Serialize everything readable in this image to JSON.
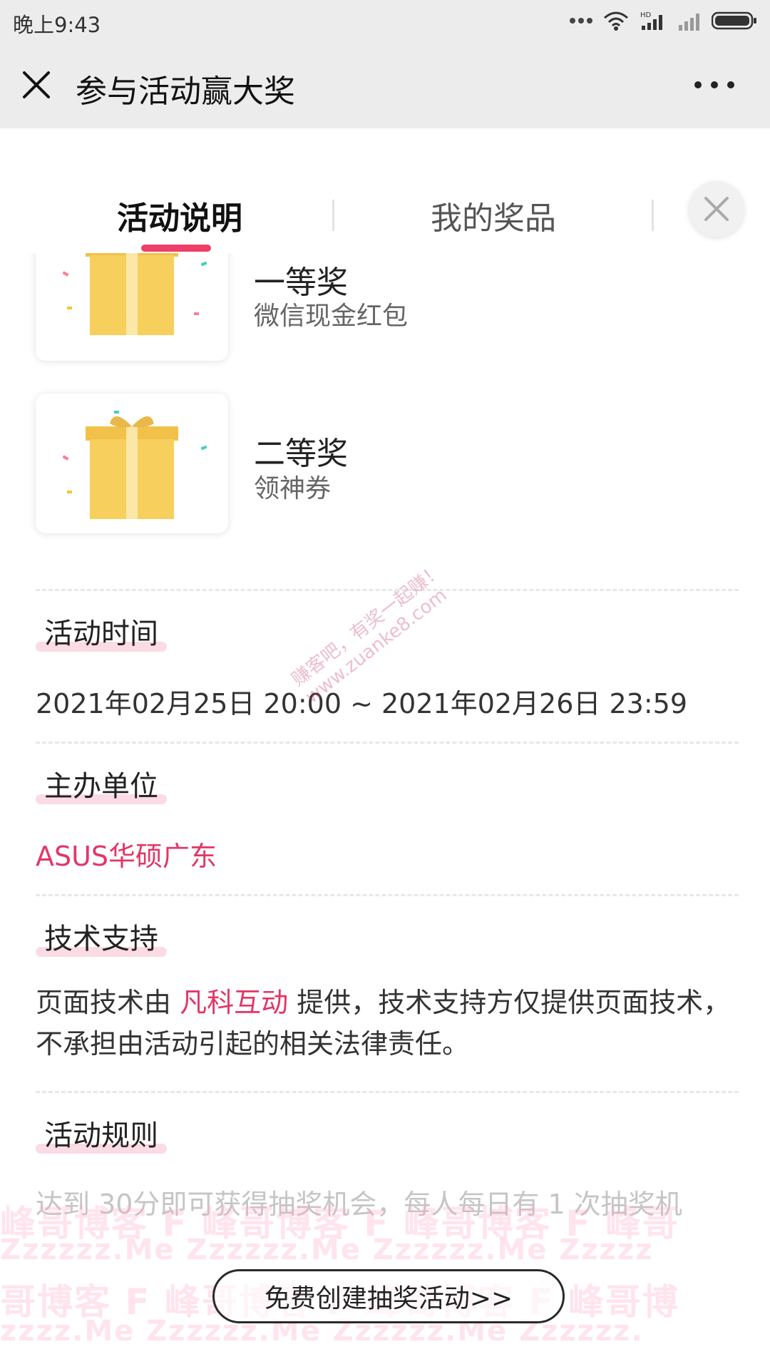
{
  "statusbar": {
    "time": "晚上9:43",
    "signal_label": "HD"
  },
  "navbar": {
    "title": "参与活动赢大奖"
  },
  "tabs": [
    {
      "label": "活动说明",
      "active": true
    },
    {
      "label": "我的奖品",
      "active": false
    }
  ],
  "prizes": [
    {
      "name": "一等奖",
      "desc": "微信现金红包"
    },
    {
      "name": "二等奖",
      "desc": "领神券"
    }
  ],
  "sections": {
    "time": {
      "title": "活动时间",
      "value": "2021年02月25日 20:00 ~ 2021年02月26日 23:59"
    },
    "organizer": {
      "title": "主办单位",
      "value": "ASUS华硕广东"
    },
    "tech": {
      "title": "技术支持",
      "prefix": "页面技术由 ",
      "link": "凡科互动",
      "suffix": " 提供，技术支持方仅提供页面技术，不承担由活动引起的相关法律责任。"
    },
    "rules": {
      "title": "活动规则",
      "text": "达到 30分即可获得抽奖机会，每人每日有 1 次抽奖机"
    }
  },
  "create_button": "免费创建抽奖活动>>",
  "watermarks": {
    "diagonal_1": "赚客吧，有奖一起赚！",
    "diagonal_2": "www.zuanke8.com",
    "band_1": "峰哥博客 F 峰哥博客 F 峰哥博客 F 峰哥",
    "band_2": "Zzzzzz.Me    Zzzzzz.Me    Zzzzzz.Me    Zzzzz",
    "band_3": "哥博客 F 峰哥博客 F 峰哥博客 F 峰哥博",
    "band_4": "zzzz.Me    Zzzzzz.Me    Zzzzzz.Me    Zzzzzz."
  },
  "colors": {
    "accent": "#ef3e68",
    "link": "#e23667",
    "bar_bg": "#ececec"
  }
}
